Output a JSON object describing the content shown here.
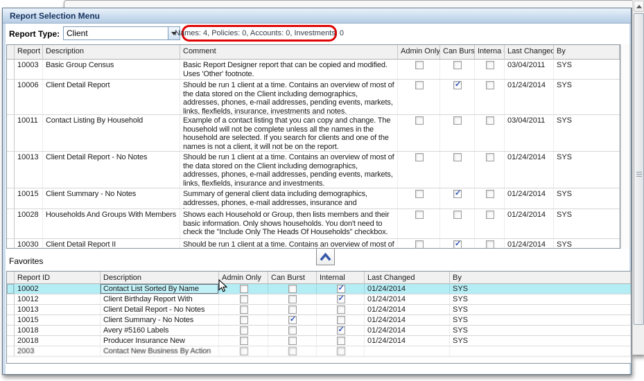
{
  "window": {
    "title": "Report Selection Menu"
  },
  "toolbar": {
    "report_type_label": "Report Type:",
    "report_type_value": "Client",
    "counts_text": "Names: 4, Policies: 0, Accounts: 0, Investments: 0"
  },
  "colors": {
    "annotation_red": "#e00404",
    "selected_row_cyan": "#b5edf5",
    "titlebar_top": "#eaf2fb",
    "titlebar_bottom": "#b6cde6",
    "checkmark_blue": "#2b50b8"
  },
  "main_table": {
    "columns": [
      "Report ID",
      "Description",
      "Comment",
      "Admin Only",
      "Can Burst",
      "Interna",
      "Last Changed",
      "By"
    ],
    "sort_column_index": 5,
    "rows": [
      {
        "id": "10003",
        "description": "Basic Group Census",
        "comment": "Basic Report Designer report that can be copied and modified.  Uses 'Other' footnote.",
        "admin_only": false,
        "can_burst": false,
        "internal": false,
        "last_changed": "03/04/2011",
        "by": "SYS"
      },
      {
        "id": "10006",
        "description": "Client Detail Report",
        "comment": "Should be run 1 client at a time. Contains an overview of most of the data stored on the Client including demographics, addresses, phones, e-mail addresses, pending events, markets, links, flexfields, insurance, investments and notes.",
        "admin_only": false,
        "can_burst": true,
        "internal": false,
        "last_changed": "01/24/2014",
        "by": "SYS"
      },
      {
        "id": "10011",
        "description": "Contact Listing By Household",
        "comment": "Example of a contact listing that you can copy and change.  The household will not be complete unless all the names in the household are selected.  If you search for clients and one of the names is not a client, it will not be on the report.",
        "admin_only": false,
        "can_burst": false,
        "internal": false,
        "last_changed": "03/04/2011",
        "by": "SYS"
      },
      {
        "id": "10013",
        "description": "Client Detail Report - No Notes",
        "comment": "Should be run 1 client at a time. Contains an overview of most of the data stored on the Client including demographics, addresses, phones, e-mail addresses, pending events, markets, links, flexfields, insurance and investments.",
        "admin_only": false,
        "can_burst": false,
        "internal": false,
        "last_changed": "01/24/2014",
        "by": "SYS"
      },
      {
        "id": "10015",
        "description": "Client Summary - No Notes",
        "comment": "Summary of general client data including demographics, addresses, phones, e-mail addresses, insurance and investments.",
        "admin_only": false,
        "can_burst": true,
        "internal": false,
        "last_changed": "01/24/2014",
        "by": "SYS"
      },
      {
        "id": "10028",
        "description": "Households And Groups With Members",
        "comment": "Shows each Household or Group, then lists members and their basic information. Only shows households. You don't need to check the \"Include Only The Heads Of Households\" checkbox.",
        "admin_only": false,
        "can_burst": false,
        "internal": false,
        "last_changed": "01/24/2014",
        "by": "SYS"
      },
      {
        "id": "10030",
        "description": "Client Detail Report II",
        "comment": "Should be run 1 client at a time. Contains an overview of most of the",
        "admin_only": false,
        "can_burst": true,
        "internal": false,
        "last_changed": "01/24/2014",
        "by": "SYS"
      }
    ]
  },
  "favorites": {
    "label": "Favorites",
    "columns": [
      "Report ID",
      "Description",
      "Admin Only",
      "Can Burst",
      "Internal",
      "Last Changed",
      "By"
    ],
    "rows": [
      {
        "id": "10002",
        "description": "Contact List Sorted By Name",
        "admin_only": false,
        "can_burst": false,
        "internal": true,
        "last_changed": "01/24/2014",
        "by": "SYS",
        "selected": true
      },
      {
        "id": "10012",
        "description": "Client Birthday Report With Primary Address",
        "admin_only": false,
        "can_burst": false,
        "internal": true,
        "last_changed": "01/24/2014",
        "by": "SYS"
      },
      {
        "id": "10013",
        "description": "Client Detail Report - No Notes",
        "admin_only": false,
        "can_burst": false,
        "internal": false,
        "last_changed": "01/24/2014",
        "by": "SYS"
      },
      {
        "id": "10015",
        "description": "Client Summary - No Notes",
        "admin_only": false,
        "can_burst": true,
        "internal": false,
        "last_changed": "01/24/2014",
        "by": "SYS"
      },
      {
        "id": "10018",
        "description": "Avery #5160 Labels",
        "admin_only": false,
        "can_burst": false,
        "internal": true,
        "last_changed": "01/24/2014",
        "by": "SYS"
      },
      {
        "id": "20018",
        "description": "Producer Insurance New Business",
        "admin_only": false,
        "can_burst": false,
        "internal": false,
        "last_changed": "01/24/2014",
        "by": "SYS"
      },
      {
        "id": "2003",
        "description": "Contact New Business By Action",
        "admin_only": false,
        "can_burst": false,
        "internal": false,
        "last_changed": "",
        "by": "",
        "torn": true
      }
    ]
  }
}
